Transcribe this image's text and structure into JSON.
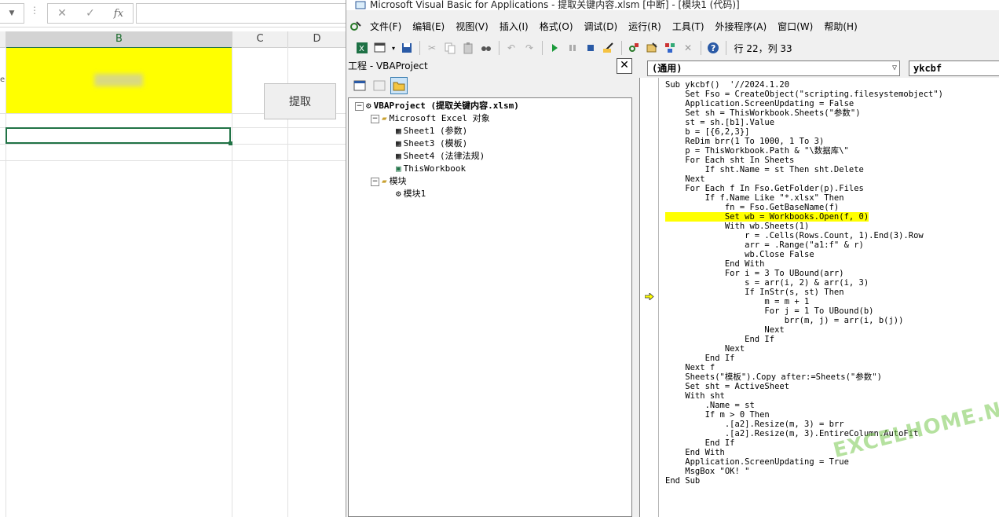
{
  "excel": {
    "fx_label": "fx",
    "columns": [
      "B",
      "C",
      "D"
    ],
    "button_label": "提取",
    "row_fragment": "e"
  },
  "vbe": {
    "title": "Microsoft Visual Basic for Applications - 提取关键内容.xlsm [中断] - [模块1 (代码)]",
    "menu": [
      "文件(F)",
      "编辑(E)",
      "视图(V)",
      "插入(I)",
      "格式(O)",
      "调试(D)",
      "运行(R)",
      "工具(T)",
      "外接程序(A)",
      "窗口(W)",
      "帮助(H)"
    ],
    "position": "行 22，列 33",
    "project": {
      "title": "工程 - VBAProject",
      "close": "✕",
      "root": "VBAProject (提取关键内容.xlsm)",
      "excel_objects": "Microsoft Excel 对象",
      "sheets": [
        "Sheet1 (参数)",
        "Sheet3 (模板)",
        "Sheet4 (法律法规)",
        "ThisWorkbook"
      ],
      "modules_folder": "模块",
      "module": "模块1"
    },
    "code": {
      "object_combo": "(通用)",
      "proc_combo": "ykcbf",
      "lines": [
        "Sub ykcbf()  '//2024.1.20",
        "    Set Fso = CreateObject(\"scripting.filesystemobject\")",
        "    Application.ScreenUpdating = False",
        "    Set sh = ThisWorkbook.Sheets(\"参数\")",
        "    st = sh.[b1].Value",
        "    b = [{6,2,3}]",
        "    ReDim brr(1 To 1000, 1 To 3)",
        "    p = ThisWorkbook.Path & \"\\数据库\\\"",
        "    For Each sht In Sheets",
        "        If sht.Name = st Then sht.Delete",
        "    Next",
        "    For Each f In Fso.GetFolder(p).Files",
        "        If f.Name Like \"*.xlsx\" Then",
        "            fn = Fso.GetBaseName(f)",
        "            Set wb = Workbooks.Open(f, 0)",
        "            With wb.Sheets(1)",
        "                r = .Cells(Rows.Count, 1).End(3).Row",
        "                arr = .Range(\"a1:f\" & r)",
        "                wb.Close False",
        "            End With",
        "            For i = 3 To UBound(arr)",
        "                s = arr(i, 2) & arr(i, 3)",
        "                If InStr(s, st) Then",
        "                    m = m + 1",
        "                    For j = 1 To UBound(b)",
        "                        brr(m, j) = arr(i, b(j))",
        "                    Next",
        "                End If",
        "            Next",
        "        End If",
        "    Next f",
        "    Sheets(\"模板\").Copy after:=Sheets(\"参数\")",
        "    Set sht = ActiveSheet",
        "    With sht",
        "        .Name = st",
        "        If m > 0 Then",
        "            .[a2].Resize(m, 3) = brr",
        "            .[a2].Resize(m, 3).EntireColumn.AutoFit",
        "        End If",
        "    End With",
        "    Application.ScreenUpdating = True",
        "    MsgBox \"OK! \"",
        "End Sub"
      ],
      "highlight_line": 14
    }
  },
  "watermark": "EXCELHOME.NET",
  "colors": {
    "excel_green": "#217346",
    "highlight": "#ffff00",
    "cell_yellow": "#ffff00"
  }
}
